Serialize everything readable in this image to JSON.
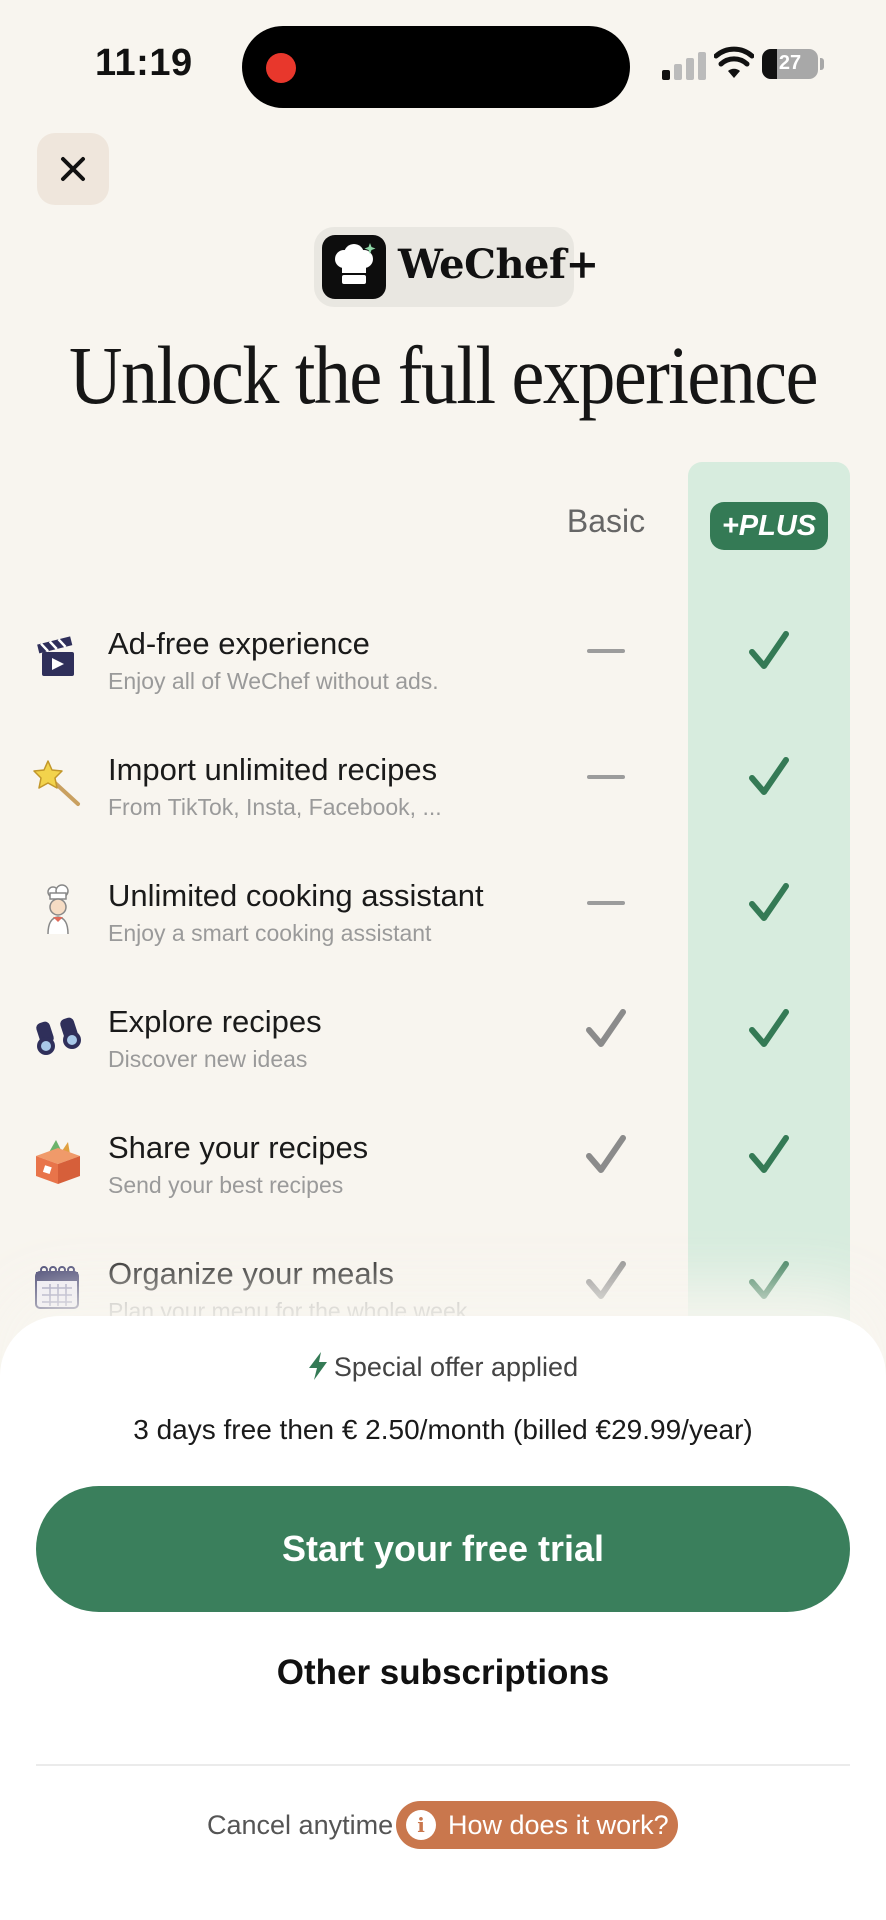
{
  "status_bar": {
    "time": "11:19",
    "battery": "27",
    "battery_level": 0.27,
    "signal_bars_on": 1
  },
  "brand": {
    "name": "WeChef+",
    "logo_icon": "chef-hat-icon"
  },
  "page": {
    "title": "Unlock the full experience",
    "close_icon": "close-icon"
  },
  "columns": {
    "basic": "Basic",
    "plus": "+PLUS"
  },
  "colors": {
    "accent_green": "#3a7f5c",
    "plus_column_bg": "#d7ecde",
    "badge_green": "#347a55",
    "check_grey": "#8b8b8b",
    "info_orange": "#c9774d",
    "page_bg": "#f8f5ef"
  },
  "features": [
    {
      "icon": "clapperboard-icon",
      "title": "Ad-free experience",
      "subtitle": "Enjoy all of WeChef without ads.",
      "basic": "dash",
      "plus": "check"
    },
    {
      "icon": "magic-wand-icon",
      "title": "Import unlimited recipes",
      "subtitle": "From TikTok, Insta, Facebook, ...",
      "basic": "dash",
      "plus": "check"
    },
    {
      "icon": "chef-assistant-icon",
      "title": "Unlimited cooking assistant",
      "subtitle": "Enjoy a smart cooking assistant",
      "basic": "dash",
      "plus": "check"
    },
    {
      "icon": "binoculars-icon",
      "title": "Explore recipes",
      "subtitle": "Discover new ideas",
      "basic": "check",
      "plus": "check"
    },
    {
      "icon": "recipe-box-icon",
      "title": "Share your recipes",
      "subtitle": "Send your best recipes",
      "basic": "check",
      "plus": "check"
    },
    {
      "icon": "calendar-icon",
      "title": "Organize your meals",
      "subtitle": "Plan your menu for the whole week",
      "basic": "check",
      "plus": "check"
    }
  ],
  "offer": {
    "special": "Special offer applied",
    "special_icon": "lightning-bolt-icon",
    "price_line": "3 days free then € 2.50/month (billed €29.99/year)"
  },
  "actions": {
    "trial_button": "Start your free trial",
    "other_subscriptions": "Other subscriptions",
    "cancel_text": "Cancel anytime",
    "how_button": "How does it work?",
    "how_icon": "info-icon",
    "info_glyph": "i"
  }
}
